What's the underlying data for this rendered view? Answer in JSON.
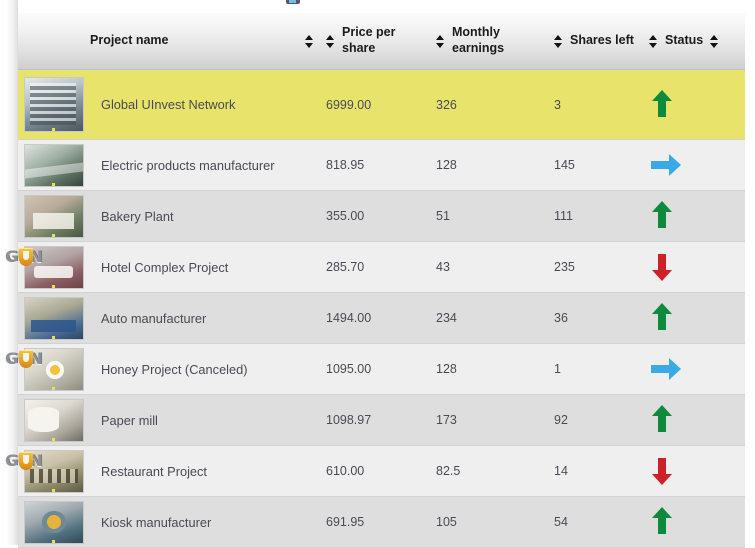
{
  "table": {
    "columns": [
      {
        "label": "Project name",
        "sortable": true,
        "sort_icon": "sort-updown-icon"
      },
      {
        "label": "Price per share",
        "sortable": true,
        "sort_icon": "sort-updown-icon"
      },
      {
        "label": "Monthly earnings",
        "sortable": true,
        "sort_icon": "sort-updown-icon"
      },
      {
        "label": "Shares left",
        "sortable": true,
        "sort_icon": "sort-updown-icon"
      },
      {
        "label": "Status",
        "sortable": true,
        "sort_icon": "sort-updown-icon"
      }
    ],
    "rows": [
      {
        "name": "Global UInvest Network",
        "price_per_share": "6999.00",
        "monthly_earnings": "326",
        "shares_left": "3",
        "status": "up",
        "highlighted": true,
        "badge": false,
        "thumb": "office-building-thumbnail"
      },
      {
        "name": "Electric products manufacturer",
        "price_per_share": "818.95",
        "monthly_earnings": "128",
        "shares_left": "145",
        "status": "right",
        "highlighted": false,
        "badge": false,
        "thumb": "electronics-factory-thumbnail"
      },
      {
        "name": "Bakery Plant",
        "price_per_share": "355.00",
        "monthly_earnings": "51",
        "shares_left": "111",
        "status": "up",
        "highlighted": false,
        "badge": false,
        "thumb": "bakery-plant-thumbnail"
      },
      {
        "name": "Hotel Complex Project",
        "price_per_share": "285.70",
        "monthly_earnings": "43",
        "shares_left": "235",
        "status": "down",
        "highlighted": false,
        "badge": true,
        "thumb": "hotel-room-thumbnail"
      },
      {
        "name": "Auto manufacturer",
        "price_per_share": "1494.00",
        "monthly_earnings": "234",
        "shares_left": "36",
        "status": "up",
        "highlighted": false,
        "badge": false,
        "thumb": "auto-factory-thumbnail"
      },
      {
        "name": "Honey Project (Canceled)",
        "price_per_share": "1095.00",
        "monthly_earnings": "128",
        "shares_left": "1",
        "status": "right",
        "highlighted": false,
        "badge": true,
        "thumb": "daisy-flower-thumbnail"
      },
      {
        "name": "Paper mill",
        "price_per_share": "1098.97",
        "monthly_earnings": "173",
        "shares_left": "92",
        "status": "up",
        "highlighted": false,
        "badge": false,
        "thumb": "paper-roll-thumbnail"
      },
      {
        "name": "Restaurant Project",
        "price_per_share": "610.00",
        "monthly_earnings": "82.5",
        "shares_left": "14",
        "status": "down",
        "highlighted": false,
        "badge": true,
        "thumb": "restaurant-interior-thumbnail"
      },
      {
        "name": "Kiosk manufacturer",
        "price_per_share": "691.95",
        "monthly_earnings": "105",
        "shares_left": "54",
        "status": "up",
        "highlighted": false,
        "badge": false,
        "thumb": "kiosk-factory-thumbnail"
      }
    ],
    "badge_label": "GUN"
  },
  "colors": {
    "row_highlight": "#e8e46b",
    "row_light": "#efefef",
    "row_dark": "#dedede",
    "status_up": "#0d8a3c",
    "status_down": "#cf2027",
    "status_flat": "#3aa9e8",
    "header_text": "#1b1b1b",
    "body_text": "#4a4a55"
  }
}
